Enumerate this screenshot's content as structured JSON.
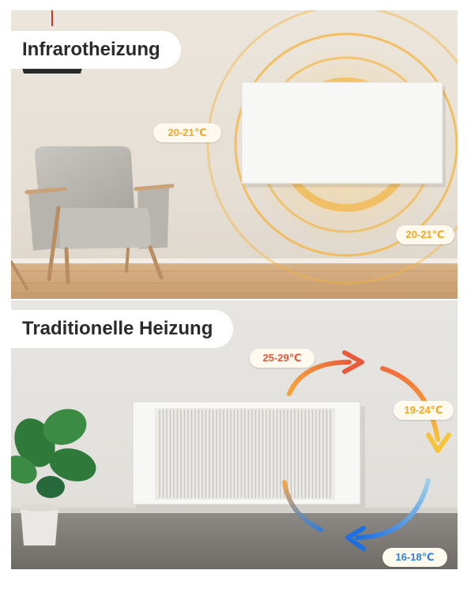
{
  "infrared": {
    "title": "Infrarotheizung",
    "temp_left": "20-21℃",
    "temp_right": "20-21℃"
  },
  "traditional": {
    "title": "Traditionelle Heizung",
    "temp_top": "25-29℃",
    "temp_right": "19-24℃",
    "temp_bottom": "16-18℃"
  },
  "colors": {
    "warm_orange": "#f5a623",
    "hot_red": "#e8573a",
    "cool_blue": "#2f7fe0",
    "panel_white": "#f7f7f5"
  }
}
